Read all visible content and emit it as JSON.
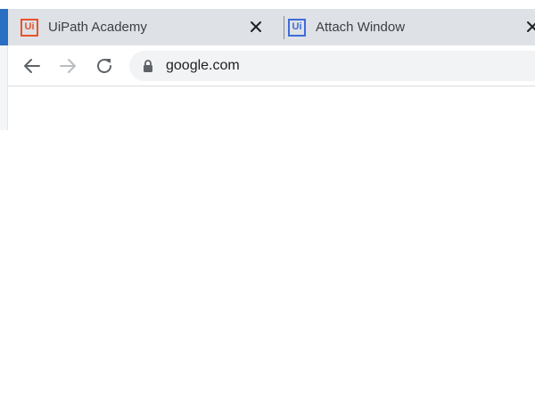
{
  "tabs": [
    {
      "favicon_text": "Ui",
      "favicon_color": "#e8542c",
      "title": "UiPath Academy",
      "close_icon": "close-icon"
    },
    {
      "favicon_text": "Ui",
      "favicon_color": "#3f6cd8",
      "title": "Attach Window",
      "close_icon": "close-icon"
    }
  ],
  "toolbar": {
    "back_icon": "arrow-left-icon",
    "forward_icon": "arrow-right-icon",
    "reload_icon": "reload-icon",
    "lock_icon": "lock-icon",
    "url": "google.com"
  },
  "colors": {
    "tabstrip_bg": "#dee1e6",
    "omnibox_bg": "#f1f3f4"
  }
}
